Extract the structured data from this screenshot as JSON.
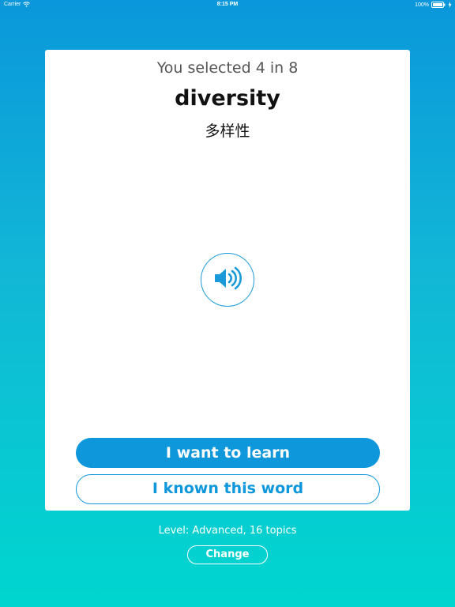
{
  "status_bar": {
    "carrier": "Carrier",
    "time": "8:15 PM",
    "battery_percent": "100%",
    "battery_level": 1.0,
    "icons": [
      "wifi-icon",
      "battery-icon",
      "charging-icon"
    ]
  },
  "card": {
    "progress_text": "You selected 4 in 8",
    "word": "diversity",
    "translation": "多样性",
    "audio_icon": "speaker-icon",
    "learn_label": "I want to learn",
    "known_label": "I known this word"
  },
  "footer": {
    "level_text": "Level: Advanced, 16 topics",
    "change_label": "Change"
  },
  "colors": {
    "accent": "#0e97da",
    "gradient_top": "#0a97db",
    "gradient_bottom": "#00d6cf",
    "card_background": "#ffffff"
  }
}
